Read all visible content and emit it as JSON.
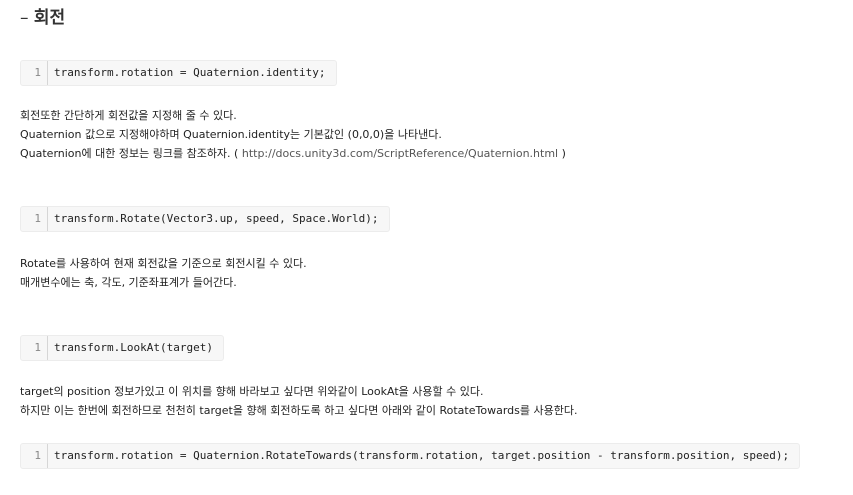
{
  "heading": {
    "dash": "– ",
    "title": "회전"
  },
  "blocks": [
    {
      "line_no": "1",
      "code": "transform.rotation = Quaternion.identity;"
    },
    {
      "line_no": "1",
      "code": "transform.Rotate(Vector3.up, speed, Space.World);"
    },
    {
      "line_no": "1",
      "code": "transform.LookAt(target)"
    },
    {
      "line_no": "1",
      "code": "transform.rotation = Quaternion.RotateTowards(transform.rotation, target.position - transform.position, speed);"
    }
  ],
  "paragraphs": {
    "p1": {
      "line1": "회전또한 간단하게 회전값을 지정해 줄 수 있다.",
      "line2": "Quaternion 값으로 지정해야하며 Quaternion.identity는 기본값인 (0,0,0)을 나타낸다.",
      "line3_prefix": "Quaternion에 대한 정보는 링크를 참조하자. ( ",
      "line3_url": "http://docs.unity3d.com/ScriptReference/Quaternion.html",
      "line3_suffix": " )"
    },
    "p2": {
      "line1": "Rotate를 사용하여 현재 회전값을 기준으로 회전시킬 수 있다.",
      "line2": "매개변수에는 축, 각도, 기준좌표계가 들어간다."
    },
    "p3": {
      "line1": "target의 position 정보가있고 이 위치를 향해 바라보고 싶다면 위와같이 LookAt을 사용할 수 있다.",
      "line2": "하지만 이는 한번에 회전하므로 천천히 target을 향해 회전하도록 하고 싶다면 아래와 같이 RotateTowards를 사용한다."
    }
  }
}
